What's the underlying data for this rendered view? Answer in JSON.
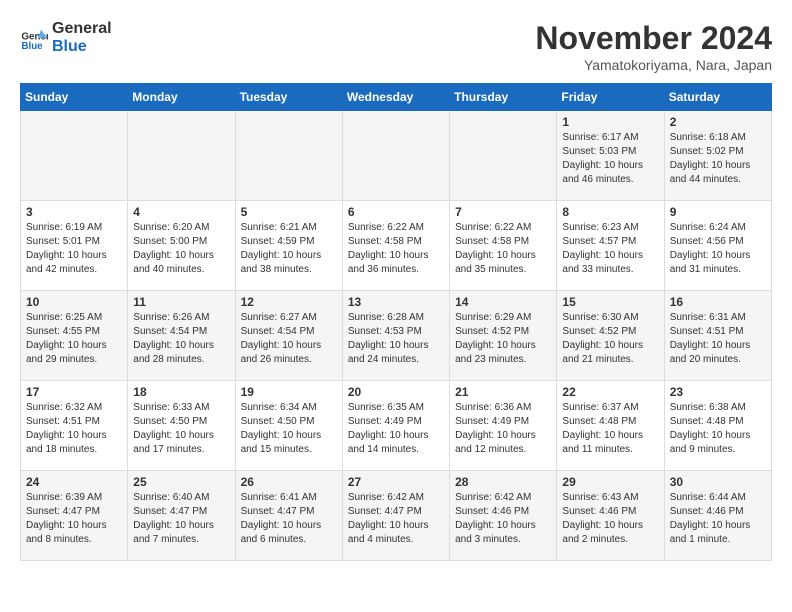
{
  "logo": {
    "line1": "General",
    "line2": "Blue"
  },
  "title": "November 2024",
  "subtitle": "Yamatokoriyama, Nara, Japan",
  "days_of_week": [
    "Sunday",
    "Monday",
    "Tuesday",
    "Wednesday",
    "Thursday",
    "Friday",
    "Saturday"
  ],
  "weeks": [
    [
      {
        "day": "",
        "info": ""
      },
      {
        "day": "",
        "info": ""
      },
      {
        "day": "",
        "info": ""
      },
      {
        "day": "",
        "info": ""
      },
      {
        "day": "",
        "info": ""
      },
      {
        "day": "1",
        "info": "Sunrise: 6:17 AM\nSunset: 5:03 PM\nDaylight: 10 hours and 46 minutes."
      },
      {
        "day": "2",
        "info": "Sunrise: 6:18 AM\nSunset: 5:02 PM\nDaylight: 10 hours and 44 minutes."
      }
    ],
    [
      {
        "day": "3",
        "info": "Sunrise: 6:19 AM\nSunset: 5:01 PM\nDaylight: 10 hours and 42 minutes."
      },
      {
        "day": "4",
        "info": "Sunrise: 6:20 AM\nSunset: 5:00 PM\nDaylight: 10 hours and 40 minutes."
      },
      {
        "day": "5",
        "info": "Sunrise: 6:21 AM\nSunset: 4:59 PM\nDaylight: 10 hours and 38 minutes."
      },
      {
        "day": "6",
        "info": "Sunrise: 6:22 AM\nSunset: 4:58 PM\nDaylight: 10 hours and 36 minutes."
      },
      {
        "day": "7",
        "info": "Sunrise: 6:22 AM\nSunset: 4:58 PM\nDaylight: 10 hours and 35 minutes."
      },
      {
        "day": "8",
        "info": "Sunrise: 6:23 AM\nSunset: 4:57 PM\nDaylight: 10 hours and 33 minutes."
      },
      {
        "day": "9",
        "info": "Sunrise: 6:24 AM\nSunset: 4:56 PM\nDaylight: 10 hours and 31 minutes."
      }
    ],
    [
      {
        "day": "10",
        "info": "Sunrise: 6:25 AM\nSunset: 4:55 PM\nDaylight: 10 hours and 29 minutes."
      },
      {
        "day": "11",
        "info": "Sunrise: 6:26 AM\nSunset: 4:54 PM\nDaylight: 10 hours and 28 minutes."
      },
      {
        "day": "12",
        "info": "Sunrise: 6:27 AM\nSunset: 4:54 PM\nDaylight: 10 hours and 26 minutes."
      },
      {
        "day": "13",
        "info": "Sunrise: 6:28 AM\nSunset: 4:53 PM\nDaylight: 10 hours and 24 minutes."
      },
      {
        "day": "14",
        "info": "Sunrise: 6:29 AM\nSunset: 4:52 PM\nDaylight: 10 hours and 23 minutes."
      },
      {
        "day": "15",
        "info": "Sunrise: 6:30 AM\nSunset: 4:52 PM\nDaylight: 10 hours and 21 minutes."
      },
      {
        "day": "16",
        "info": "Sunrise: 6:31 AM\nSunset: 4:51 PM\nDaylight: 10 hours and 20 minutes."
      }
    ],
    [
      {
        "day": "17",
        "info": "Sunrise: 6:32 AM\nSunset: 4:51 PM\nDaylight: 10 hours and 18 minutes."
      },
      {
        "day": "18",
        "info": "Sunrise: 6:33 AM\nSunset: 4:50 PM\nDaylight: 10 hours and 17 minutes."
      },
      {
        "day": "19",
        "info": "Sunrise: 6:34 AM\nSunset: 4:50 PM\nDaylight: 10 hours and 15 minutes."
      },
      {
        "day": "20",
        "info": "Sunrise: 6:35 AM\nSunset: 4:49 PM\nDaylight: 10 hours and 14 minutes."
      },
      {
        "day": "21",
        "info": "Sunrise: 6:36 AM\nSunset: 4:49 PM\nDaylight: 10 hours and 12 minutes."
      },
      {
        "day": "22",
        "info": "Sunrise: 6:37 AM\nSunset: 4:48 PM\nDaylight: 10 hours and 11 minutes."
      },
      {
        "day": "23",
        "info": "Sunrise: 6:38 AM\nSunset: 4:48 PM\nDaylight: 10 hours and 9 minutes."
      }
    ],
    [
      {
        "day": "24",
        "info": "Sunrise: 6:39 AM\nSunset: 4:47 PM\nDaylight: 10 hours and 8 minutes."
      },
      {
        "day": "25",
        "info": "Sunrise: 6:40 AM\nSunset: 4:47 PM\nDaylight: 10 hours and 7 minutes."
      },
      {
        "day": "26",
        "info": "Sunrise: 6:41 AM\nSunset: 4:47 PM\nDaylight: 10 hours and 6 minutes."
      },
      {
        "day": "27",
        "info": "Sunrise: 6:42 AM\nSunset: 4:47 PM\nDaylight: 10 hours and 4 minutes."
      },
      {
        "day": "28",
        "info": "Sunrise: 6:42 AM\nSunset: 4:46 PM\nDaylight: 10 hours and 3 minutes."
      },
      {
        "day": "29",
        "info": "Sunrise: 6:43 AM\nSunset: 4:46 PM\nDaylight: 10 hours and 2 minutes."
      },
      {
        "day": "30",
        "info": "Sunrise: 6:44 AM\nSunset: 4:46 PM\nDaylight: 10 hours and 1 minute."
      }
    ]
  ]
}
